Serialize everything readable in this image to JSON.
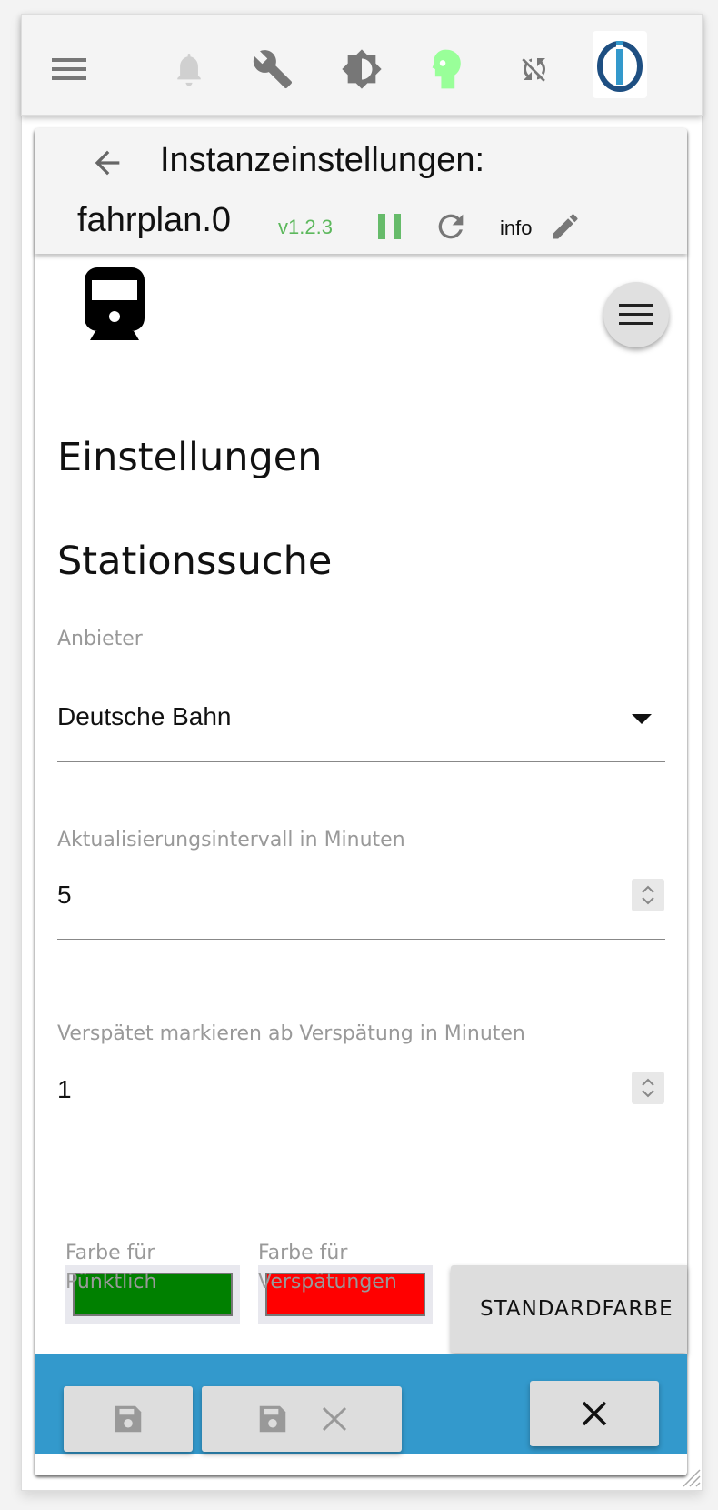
{
  "toolbar": {
    "icons": [
      "menu-icon",
      "bell-icon",
      "wrench-icon",
      "brightness-icon",
      "expert-mode-head-icon",
      "sync-disabled-icon",
      "iobroker-logo"
    ],
    "expert_color": "#99ff99"
  },
  "header": {
    "title": "Instanzeinstellungen:",
    "instance": "fahrplan.0",
    "version": "v1.2.3",
    "info_label": "info",
    "version_color": "#5cb85c"
  },
  "content": {
    "heading": "Einstellungen",
    "section": "Stationssuche",
    "provider": {
      "label": "Anbieter",
      "value": "Deutsche Bahn"
    },
    "interval": {
      "label": "Aktualisierungsintervall in Minuten",
      "value": "5"
    },
    "delay": {
      "label": "Verspätet markieren ab Verspätung in Minuten",
      "value": "1"
    },
    "color_ontime": {
      "label": "Farbe für Pünktlich",
      "value": "#008000"
    },
    "color_delayed": {
      "label": "Farbe für Verspätungen",
      "value": "#ff0000"
    },
    "default_colors_button": "STANDARDFARBE"
  },
  "footer": {
    "bar_color": "#3399cc"
  }
}
